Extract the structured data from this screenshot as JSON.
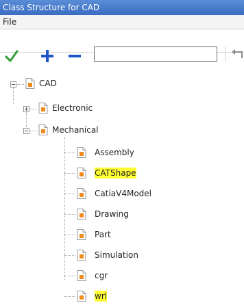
{
  "window": {
    "title": "Class Structure for CAD"
  },
  "menu": {
    "file_label": "File"
  },
  "toolbar": {
    "confirm_icon": "checkmark-icon",
    "add_icon": "plus-icon",
    "remove_icon": "minus-icon",
    "undo_icon": "undo-arrow-icon",
    "search_value": ""
  },
  "tree": {
    "root": {
      "label": "CAD",
      "expanded": true
    },
    "electronic": {
      "label": "Electronic",
      "expanded": false
    },
    "mechanical": {
      "label": "Mechanical",
      "expanded": true
    },
    "mechanical_children": [
      {
        "label": "Assembly",
        "highlighted": false
      },
      {
        "label": "CATShape",
        "highlighted": true
      },
      {
        "label": "CatiaV4Model",
        "highlighted": false
      },
      {
        "label": "Drawing",
        "highlighted": false
      },
      {
        "label": "Part",
        "highlighted": false
      },
      {
        "label": "Simulation",
        "highlighted": false
      },
      {
        "label": "cgr",
        "highlighted": false
      },
      {
        "label": "wrl",
        "highlighted": true
      }
    ]
  },
  "colors": {
    "titlebar": "#3a6cc2",
    "highlight": "#ffff33",
    "check_green": "#3aa040",
    "add_blue": "#1f57c8",
    "icon_orange": "#f08a1c"
  }
}
